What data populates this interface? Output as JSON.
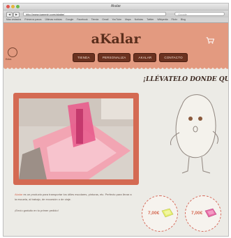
{
  "browser": {
    "window_title": "Akalar",
    "url": "http://www.juanmiri.com/akalar/",
    "search_placeholder": "Google",
    "bookmarks": [
      "Mas visitados",
      "Primeros pasos",
      "Últimas noticias",
      "Google",
      "Facebook",
      "Tienda",
      "Gmail",
      "YouTube",
      "Maps",
      "Noticias",
      "Twitter",
      "Wikipedia",
      "Flickr",
      "Blog"
    ]
  },
  "site": {
    "logo": "aKalar",
    "login_label": "Entra",
    "menu": [
      "TIENDA",
      "PERSONALIZA",
      "AKALAR",
      "CONTACTO"
    ],
    "headline": "¡LLÉVATELO DONDE QUIERAS!",
    "description_brand": "Akalar",
    "description_rest": " es un producto para transportar los útiles escolares, pinturas, etc. Perfecto para llevar a la escuela, al trabajo, de excursión o de viaje.",
    "promo": "¡Envío gratuito en tu primer pedido!",
    "products": [
      {
        "price": "7,00€",
        "color": "#e6ef6f"
      },
      {
        "price": "7,00€",
        "color": "#e86aa6"
      }
    ]
  },
  "colors": {
    "header": "#e39a80",
    "menu_button": "#6b3220",
    "accent": "#d46a53",
    "background": "#ecebe6"
  }
}
